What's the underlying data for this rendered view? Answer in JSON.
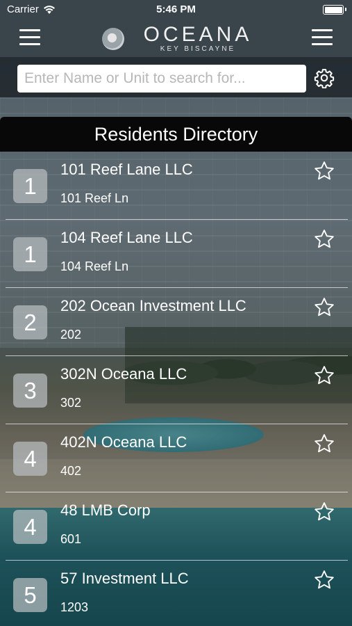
{
  "status_bar": {
    "carrier": "Carrier",
    "time": "5:46 PM",
    "battery_level": 1.0
  },
  "header": {
    "brand_name": "OCEANA",
    "brand_subtitle": "KEY BISCAYNE",
    "left_menu_icon": "hamburger-icon",
    "right_menu_icon": "hamburger-icon",
    "logo_icon": "circle-logo-icon"
  },
  "search": {
    "placeholder": "Enter Name or Unit to search for...",
    "value": "",
    "settings_icon": "gear-icon"
  },
  "directory": {
    "title": "Residents Directory",
    "residents": [
      {
        "badge": "1",
        "name": "101 Reef Lane LLC",
        "unit": "101 Reef Ln",
        "favorite_icon": "star-outline-icon"
      },
      {
        "badge": "1",
        "name": "104 Reef Lane LLC",
        "unit": "104 Reef Ln",
        "favorite_icon": "star-outline-icon"
      },
      {
        "badge": "2",
        "name": "202 Ocean Investment LLC",
        "unit": "202",
        "favorite_icon": "star-outline-icon"
      },
      {
        "badge": "3",
        "name": "302N Oceana LLC",
        "unit": "302",
        "favorite_icon": "star-outline-icon"
      },
      {
        "badge": "4",
        "name": "402N Oceana LLC",
        "unit": "402",
        "favorite_icon": "star-outline-icon"
      },
      {
        "badge": "4",
        "name": "48 LMB Corp",
        "unit": "601",
        "favorite_icon": "star-outline-icon"
      },
      {
        "badge": "5",
        "name": "57 Investment LLC",
        "unit": "1203",
        "favorite_icon": "star-outline-icon"
      }
    ]
  },
  "colors": {
    "header_bg": "#3a444b",
    "title_bar_bg": "#080808",
    "badge_bg": "#b9bec0",
    "text": "#ffffff"
  }
}
